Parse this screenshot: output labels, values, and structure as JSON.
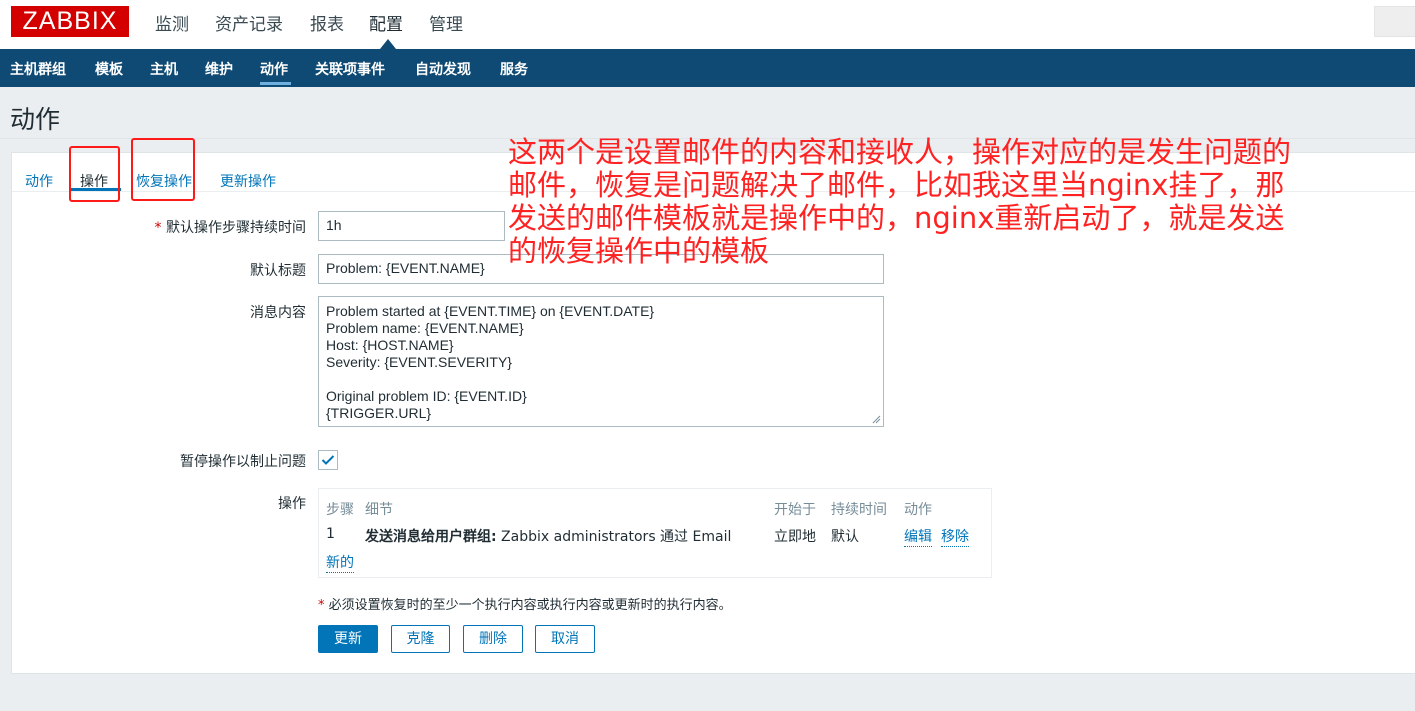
{
  "logo": "ZABBIX",
  "topnav": [
    {
      "label": "监测",
      "active": false
    },
    {
      "label": "资产记录",
      "active": false
    },
    {
      "label": "报表",
      "active": false
    },
    {
      "label": "配置",
      "active": true
    },
    {
      "label": "管理",
      "active": false
    }
  ],
  "subnav": [
    {
      "label": "主机群组"
    },
    {
      "label": "模板"
    },
    {
      "label": "主机"
    },
    {
      "label": "维护"
    },
    {
      "label": "动作",
      "active": true
    },
    {
      "label": "关联项事件"
    },
    {
      "label": "自动发现"
    },
    {
      "label": "服务"
    }
  ],
  "page_title": "动作",
  "tabs": [
    {
      "label": "动作",
      "active": false
    },
    {
      "label": "操作",
      "active": true
    },
    {
      "label": "恢复操作",
      "active": false
    },
    {
      "label": "更新操作",
      "active": false
    }
  ],
  "form": {
    "required_mark": "*",
    "step_duration_label": "默认操作步骤持续时间",
    "step_duration_value": "1h",
    "subject_label": "默认标题",
    "subject_value": "Problem: {EVENT.NAME}",
    "message_label": "消息内容",
    "message_value": "Problem started at {EVENT.TIME} on {EVENT.DATE}\nProblem name: {EVENT.NAME}\nHost: {HOST.NAME}\nSeverity: {EVENT.SEVERITY}\n\nOriginal problem ID: {EVENT.ID}\n{TRIGGER.URL}",
    "pause_label": "暂停操作以制止问题",
    "pause_checked": true,
    "operations_label": "操作"
  },
  "operations_table": {
    "headers": {
      "steps": "步骤",
      "details": "细节",
      "start_in": "开始于",
      "duration": "持续时间",
      "action": "动作"
    },
    "rows": [
      {
        "step": "1",
        "detail_bold": "发送消息给用户群组:",
        "detail_rest": " Zabbix administrators 通过 Email",
        "start_in": "立即地",
        "duration": "默认",
        "edit": "编辑",
        "remove": "移除"
      }
    ],
    "new_link": "新的"
  },
  "note": "必须设置恢复时的至少一个执行内容或执行内容或更新时的执行内容。",
  "buttons": {
    "update": "更新",
    "clone": "克隆",
    "delete": "删除",
    "cancel": "取消"
  },
  "annotation": "这两个是设置邮件的内容和接收人，操作对应的是发生问题的\n邮件，恢复是问题解决了邮件，比如我这里当nginx挂了，那\n发送的邮件模板就是操作中的，nginx重新启动了，就是发送\n的恢复操作中的模板",
  "colors": {
    "logo": "#d40000",
    "subnav": "#0e4a73",
    "link": "#0275b8",
    "annotation": "#ff2222"
  }
}
